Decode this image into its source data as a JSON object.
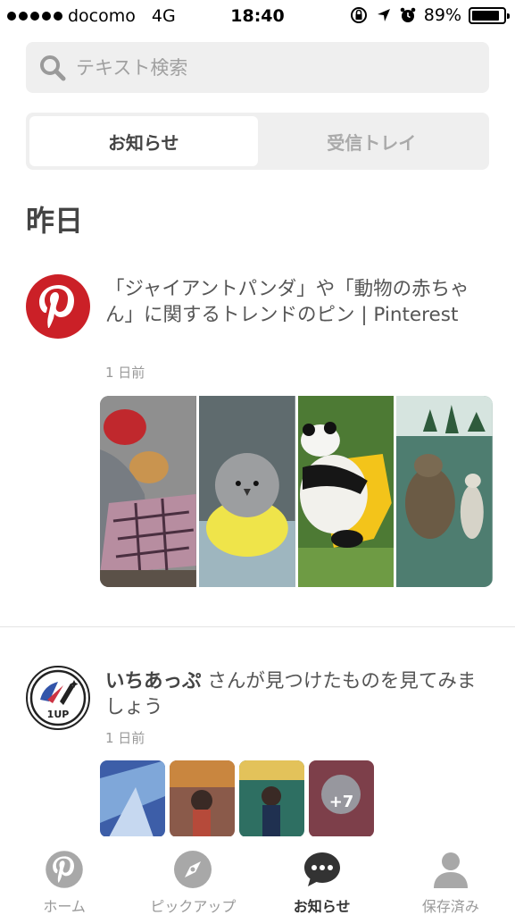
{
  "status_bar": {
    "carrier": "docomo",
    "network": "4G",
    "time": "18:40",
    "battery": "89%",
    "battery_level": 0.89
  },
  "search": {
    "placeholder": "テキスト検索"
  },
  "segments": [
    {
      "label": "お知らせ",
      "active": true
    },
    {
      "label": "受信トレイ",
      "active": false
    }
  ],
  "section_title": "昨日",
  "notifications": [
    {
      "text": "「ジャイアントパンダ」や「動物の赤ちゃん」に関するトレンドのピン | Pinterest",
      "time": "1 日前",
      "avatar": "pinterest-logo-icon"
    },
    {
      "name": "いちあっぷ",
      "text_suffix": " さんが見つけたものを見てみましょう",
      "time": "1 日前",
      "avatar": "1up-logo",
      "avatar_text": "1UP",
      "more_badge": "+7"
    }
  ],
  "tabs": [
    {
      "label": "ホーム",
      "icon": "pinterest-home-icon",
      "active": false
    },
    {
      "label": "ピックアップ",
      "icon": "compass-icon",
      "active": false
    },
    {
      "label": "お知らせ",
      "icon": "chat-bubble-icon",
      "active": true
    },
    {
      "label": "保存済み",
      "icon": "person-icon",
      "active": false
    }
  ],
  "colors": {
    "pinterest_red": "#cb2027",
    "gray_bg": "#efefef",
    "inactive_gray": "#a8a8a8"
  }
}
